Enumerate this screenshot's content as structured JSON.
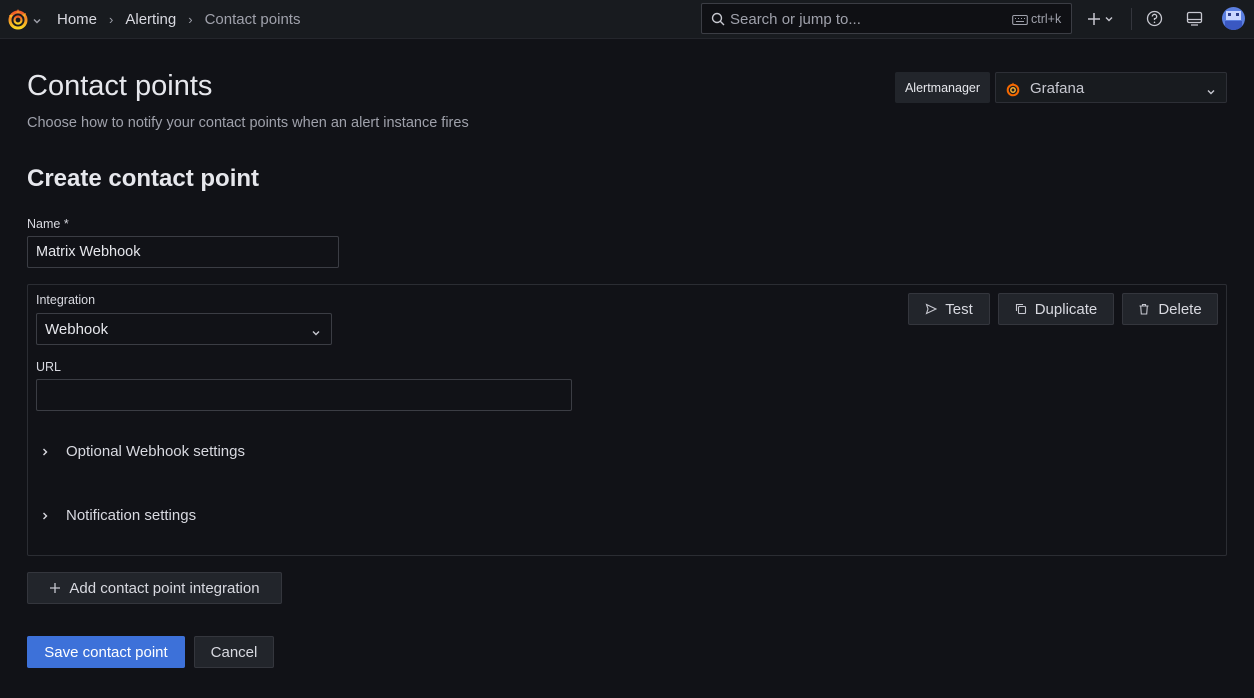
{
  "topbar": {
    "breadcrumbs": [
      "Home",
      "Alerting",
      "Contact points"
    ],
    "search_placeholder": "Search or jump to...",
    "search_shortcut": "ctrl+k"
  },
  "header": {
    "title": "Contact points",
    "subtitle": "Choose how to notify your contact points when an alert instance fires",
    "alertmanager_label": "Alertmanager",
    "alertmanager_value": "Grafana"
  },
  "form": {
    "section_title": "Create contact point",
    "name_label": "Name *",
    "name_value": "Matrix Webhook",
    "integration": {
      "label": "Integration",
      "value": "Webhook",
      "url_label": "URL",
      "url_value": "",
      "test_label": "Test",
      "duplicate_label": "Duplicate",
      "delete_label": "Delete",
      "optional_settings_label": "Optional Webhook settings",
      "notification_settings_label": "Notification settings"
    },
    "add_integration_label": "Add contact point integration",
    "save_label": "Save contact point",
    "cancel_label": "Cancel"
  },
  "colors": {
    "background": "#111217",
    "primary": "#3d71d9",
    "grafana_orange": "#f46800"
  }
}
